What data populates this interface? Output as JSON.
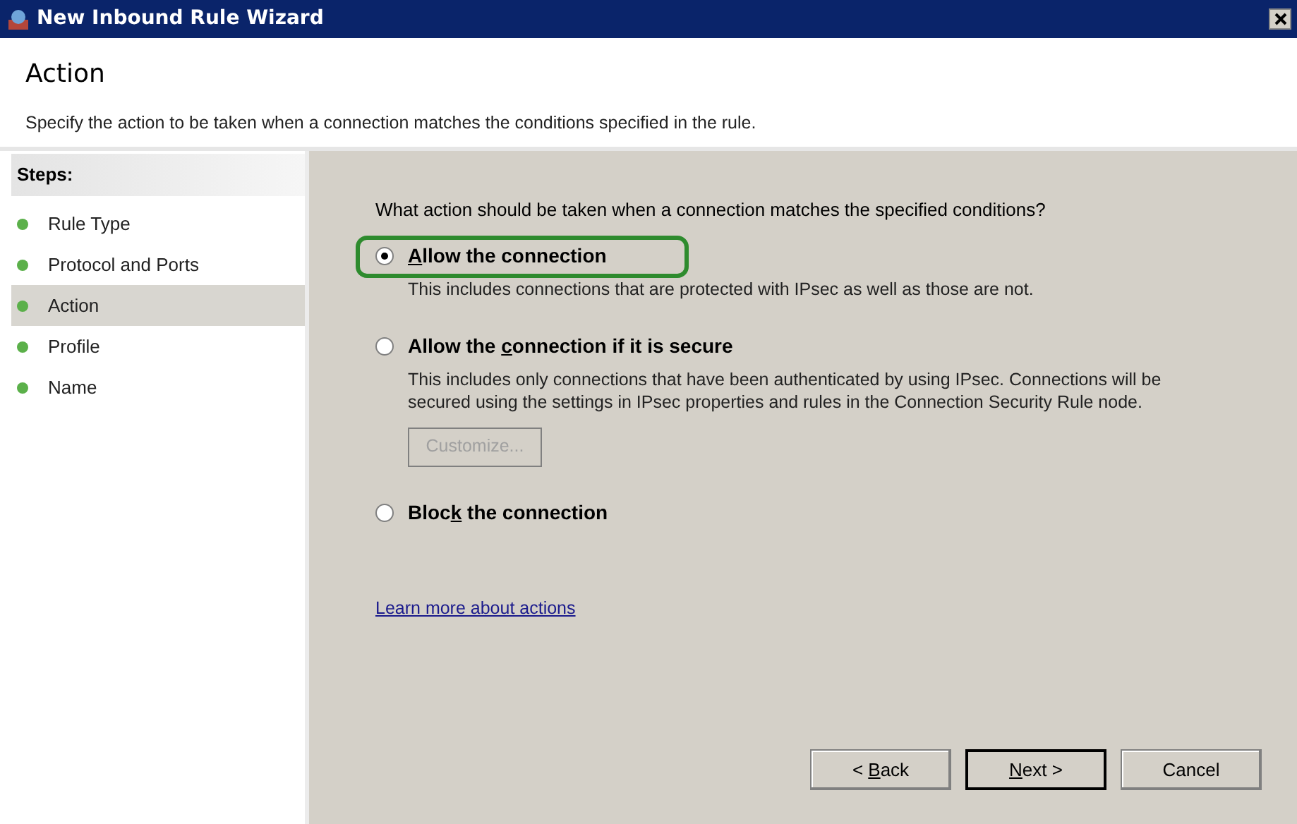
{
  "window": {
    "title": "New Inbound Rule Wizard"
  },
  "header": {
    "title": "Action",
    "description": "Specify the action to be taken when a connection matches the conditions specified in the rule."
  },
  "steps": {
    "heading": "Steps:",
    "items": [
      {
        "label": "Rule Type",
        "selected": false
      },
      {
        "label": "Protocol and Ports",
        "selected": false
      },
      {
        "label": "Action",
        "selected": true
      },
      {
        "label": "Profile",
        "selected": false
      },
      {
        "label": "Name",
        "selected": false
      }
    ]
  },
  "question": "What action should be taken when a connection matches the specified conditions?",
  "options": [
    {
      "label": {
        "key": "A",
        "after": "llow the connection"
      },
      "selected": true,
      "highlighted": true,
      "description": "This includes connections that are protected with IPsec as well as those are not."
    },
    {
      "label": {
        "before": "Allow the ",
        "key": "c",
        "after": "onnection if it is secure"
      },
      "selected": false,
      "highlighted": false,
      "description": "This includes only connections that have been authenticated by using IPsec.  Connections will be secured using the settings in IPsec properties and rules in the Connection Security Rule node.",
      "button": {
        "label": "Customize...",
        "disabled": true
      }
    },
    {
      "label": {
        "before": "Bloc",
        "key": "k",
        "after": " the connection"
      },
      "selected": false,
      "highlighted": false
    }
  ],
  "link": "Learn more about actions",
  "buttons": [
    {
      "label": {
        "before": "< ",
        "key": "B",
        "after": "ack"
      },
      "default": false
    },
    {
      "label": {
        "key": "N",
        "after": "ext >"
      },
      "default": true
    },
    {
      "label": {
        "before": "Cancel"
      },
      "default": false
    }
  ]
}
